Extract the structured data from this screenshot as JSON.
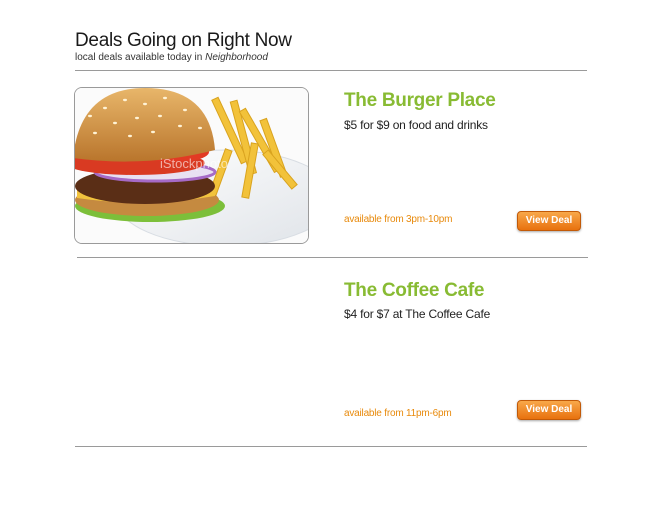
{
  "header": {
    "title": "Deals Going on Right Now",
    "subtitle_prefix": "local deals available today in",
    "neighborhood": "Neighborhood"
  },
  "deals": [
    {
      "name": "The Burger Place",
      "description": "$5 for $9 on food and drinks",
      "availability": "available from 3pm-10pm",
      "button_label": "View Deal",
      "image_watermark": "iStockphoto"
    },
    {
      "name": "The Coffee Cafe",
      "description": "$4 for $7 at The Coffee Cafe",
      "availability": "available from 11pm-6pm",
      "button_label": "View Deal"
    }
  ],
  "colors": {
    "deal_name": "#88bb33",
    "availability": "#e88a0c",
    "button": "#f08a24"
  }
}
